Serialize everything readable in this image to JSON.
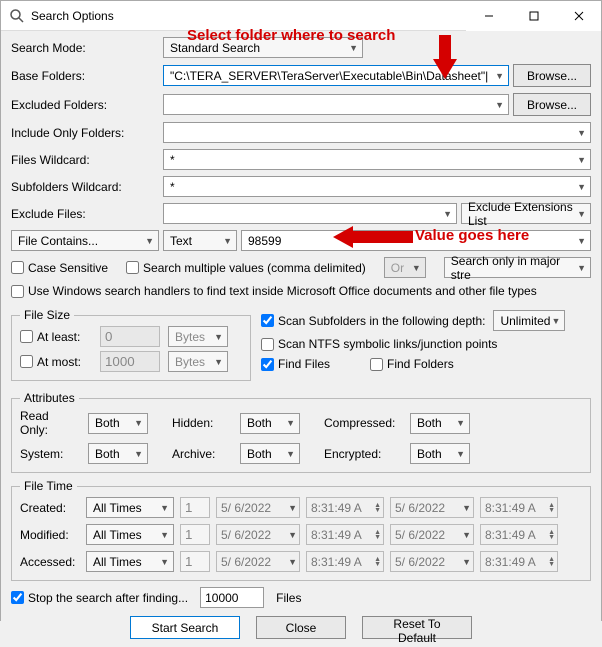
{
  "window": {
    "title": "Search Options"
  },
  "annotations": {
    "folder_hint": "Select folder where to search",
    "value_hint": "Value goes here"
  },
  "labels": {
    "search_mode": "Search Mode:",
    "base_folders": "Base Folders:",
    "excluded_folders": "Excluded Folders:",
    "include_only": "Include Only Folders:",
    "files_wildcard": "Files Wildcard:",
    "subfolders_wildcard": "Subfolders Wildcard:",
    "exclude_files": "Exclude Files:",
    "browse": "Browse...",
    "exclude_ext_list": "Exclude Extensions List",
    "file_contains": "File Contains...",
    "text": "Text",
    "case_sensitive": "Case Sensitive",
    "search_multiple": "Search multiple values (comma delimited)",
    "or": "Or",
    "search_major": "Search only in major stre",
    "use_handlers": "Use Windows search handlers to find text inside Microsoft Office documents and other file types",
    "file_size": "File Size",
    "at_least": "At least:",
    "at_most": "At most:",
    "bytes": "Bytes",
    "scan_subfolders": "Scan Subfolders in the following depth:",
    "unlimited": "Unlimited",
    "scan_ntfs": "Scan NTFS symbolic links/junction points",
    "find_files": "Find Files",
    "find_folders": "Find Folders",
    "attributes": "Attributes",
    "read_only": "Read Only:",
    "hidden": "Hidden:",
    "compressed": "Compressed:",
    "system": "System:",
    "archive": "Archive:",
    "encrypted": "Encrypted:",
    "both": "Both",
    "file_time": "File Time",
    "created": "Created:",
    "modified": "Modified:",
    "accessed": "Accessed:",
    "all_times": "All Times",
    "stop_after": "Stop the search after finding...",
    "files_suffix": "Files",
    "start_search": "Start Search",
    "close": "Close",
    "reset": "Reset To Default"
  },
  "values": {
    "search_mode": "Standard Search",
    "base_folder": "\"C:\\TERA_SERVER\\TeraServer\\Executable\\Bin\\Datasheet\"|",
    "excluded_folders": "",
    "include_only": "",
    "files_wildcard": "*",
    "subfolders_wildcard": "*",
    "exclude_files": "",
    "search_value": "98599",
    "at_least": "0",
    "at_most": "1000",
    "ft_num": "1",
    "ft_date": "5/ 6/2022",
    "ft_time": "8:31:49 A",
    "stop_count": "10000"
  },
  "checks": {
    "case_sensitive": false,
    "search_multiple": false,
    "use_handlers": false,
    "at_least": false,
    "at_most": false,
    "scan_subfolders": true,
    "scan_ntfs": false,
    "find_files": true,
    "find_folders": false,
    "stop_after": true
  }
}
